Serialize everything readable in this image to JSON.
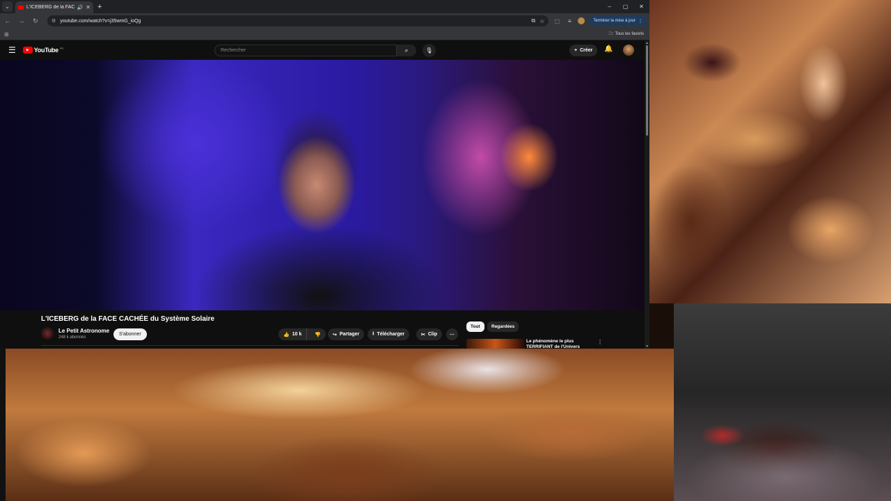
{
  "browser": {
    "tab_title": "L'ICEBERG de la FACE CACHÉE du Système Solaire",
    "new_tab_icon": "+",
    "url": "youtube.com/watch?v=j35wmG_ioQg",
    "update_button": "Terminer la mise à jour",
    "bookmarks_all": "Tous les favoris",
    "window_controls": [
      "–",
      "▢",
      "✕"
    ]
  },
  "youtube": {
    "logo_text": "YouTube",
    "logo_region": "FR",
    "search_placeholder": "Rechercher",
    "create_label": "Créer",
    "video": {
      "title": "L'ICEBERG de la FACE CACHÉE du Système Solaire",
      "channel_name": "Le Petit Astronome",
      "subscribers": "248 k abonnés",
      "subscribe_label": "S'abonner",
      "likes": "10 k",
      "share_label": "Partager",
      "download_label": "Télécharger",
      "clip_label": "Clip"
    },
    "chips": [
      "Tout",
      "Regardées"
    ],
    "recommendation": {
      "title": "Le phénomène le plus TERRIFIANT de l'Univers"
    }
  },
  "icons": [
    "menu-icon",
    "search-icon",
    "mic-icon",
    "bell-icon",
    "like-icon",
    "dislike-icon",
    "share-icon",
    "download-icon",
    "scissors-icon",
    "more-icon"
  ]
}
